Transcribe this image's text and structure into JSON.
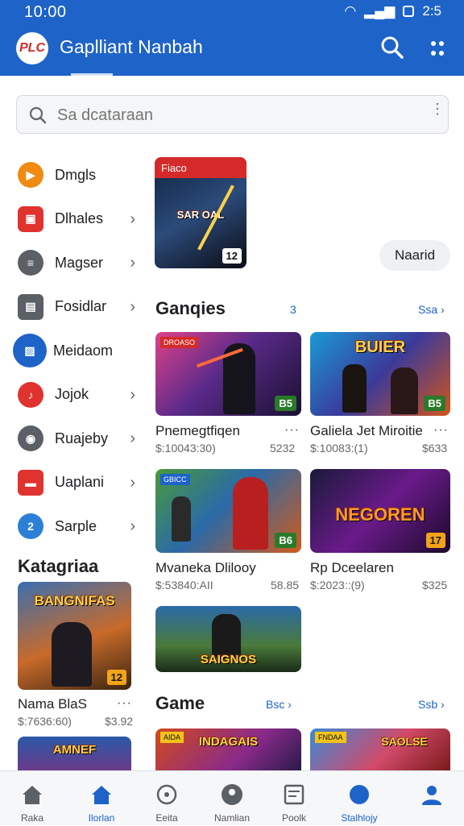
{
  "status_bar": {
    "time": "10:00",
    "right": "2:5"
  },
  "app_bar": {
    "logo_text": "PLC",
    "title": "Gaplliant Nanbah"
  },
  "search": {
    "placeholder": "Sa dcataraan"
  },
  "sidebar": {
    "items": [
      {
        "label": "Dmgls",
        "color": "#f08a12",
        "icon": "play-icon"
      },
      {
        "label": "Dlhales",
        "color": "#e0322e",
        "icon": "tv-icon"
      },
      {
        "label": "Magser",
        "color": "#5b5f66",
        "icon": "document-icon"
      },
      {
        "label": "Fosidlar",
        "color": "#5b5f66",
        "icon": "collection-icon"
      },
      {
        "label": "Meidaom",
        "color": "#1e63c8",
        "icon": "image-icon",
        "active": true
      },
      {
        "label": "Jojok",
        "color": "#e0322e",
        "icon": "music-icon"
      },
      {
        "label": "Ruajeby",
        "color": "#5b5f66",
        "icon": "ring-icon"
      },
      {
        "label": "Uaplani",
        "color": "#e0322e",
        "icon": "video-icon"
      },
      {
        "label": "Sarple",
        "color": "#2c7fd6",
        "icon": "sample-icon",
        "badge": "2"
      }
    ]
  },
  "categories": {
    "title": "Katagriaa",
    "card": {
      "title": "Nama BlaS",
      "meta": "$:7636:60)",
      "price": "$3.92",
      "art_text": "BANGNIFAS",
      "badge": "12"
    },
    "card2": {
      "art_text": "AMNEF"
    }
  },
  "featured": {
    "tag": "Fiaco",
    "art_text": "SAR OAL",
    "badge": "12",
    "button_label": "Naarid"
  },
  "section1": {
    "title": "Ganqies",
    "mid": "3",
    "link": "Ssa",
    "games": [
      {
        "title": "Pnemegtfiqen",
        "meta": "$:10043:30)",
        "price": "5232",
        "badge": "B5",
        "art": "",
        "tag": "DROASO"
      },
      {
        "title": "Galiela Jet Miroitie",
        "meta": "$:10083:(1)",
        "price": "$633",
        "badge": "B5",
        "art": "BUIER",
        "tag": ""
      },
      {
        "title": "Mvaneka Dlilooy",
        "meta": "$:53840:AII",
        "price": "58.85",
        "badge": "B6",
        "art": "",
        "tag": "GBICC"
      },
      {
        "title": "Rp Dceelaren",
        "meta": "$:2023::(9)",
        "price": "$325",
        "badge": "17",
        "art": "NEGOREN",
        "tag": ""
      },
      {
        "title": "",
        "meta": "",
        "price": "",
        "badge": "",
        "art": "SAIGNOS",
        "tag": ""
      }
    ]
  },
  "section2": {
    "title": "Game",
    "link": "Bsc",
    "link2": "Ssb",
    "games": [
      {
        "art": "INDAGAIS",
        "tag": "AIDA"
      },
      {
        "art": "SAOLSE",
        "tag": "FNDAA"
      }
    ]
  },
  "bottom_nav": {
    "items": [
      {
        "label": "Raka",
        "icon": "home-icon"
      },
      {
        "label": "Ilorlan",
        "icon": "house-icon",
        "active": true
      },
      {
        "label": "Eeita",
        "icon": "compass-icon"
      },
      {
        "label": "Namlian",
        "icon": "location-icon"
      },
      {
        "label": "Poolk",
        "icon": "list-icon"
      },
      {
        "label": "Stalhlojy",
        "icon": "circle-icon",
        "active": true
      },
      {
        "label": "",
        "icon": "profile-icon",
        "active": true
      }
    ]
  },
  "colors": {
    "brand": "#1e63c8",
    "danger": "#e0322e",
    "accent": "#f08a12"
  }
}
